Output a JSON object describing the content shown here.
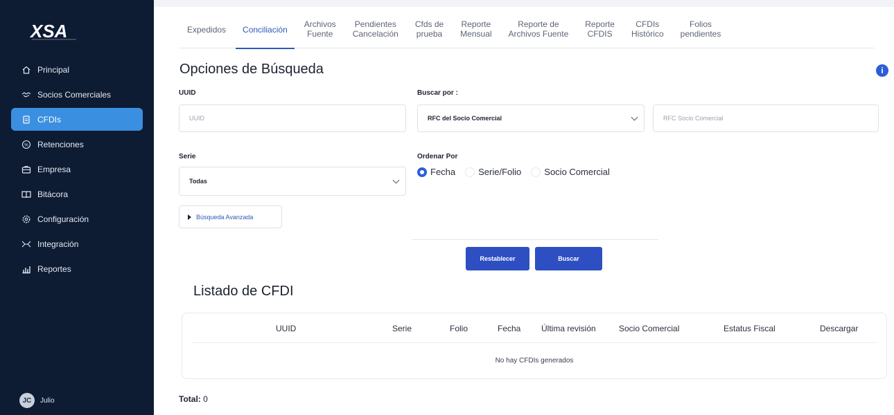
{
  "sidebar": {
    "logo_text": "XSA",
    "items": [
      {
        "label": "Principal",
        "icon": "home-icon"
      },
      {
        "label": "Socios Comerciales",
        "icon": "handshake-icon"
      },
      {
        "label": "CFDIs",
        "icon": "document-icon"
      },
      {
        "label": "Retenciones",
        "icon": "percent-circle-icon"
      },
      {
        "label": "Empresa",
        "icon": "briefcase-icon"
      },
      {
        "label": "Bitácora",
        "icon": "book-icon"
      },
      {
        "label": "Configuración",
        "icon": "gear-icon"
      },
      {
        "label": "Integración",
        "icon": "integration-icon"
      },
      {
        "label": "Reportes",
        "icon": "chart-icon"
      }
    ],
    "active_index": 2,
    "user": {
      "initials": "JC",
      "name": "Julio"
    }
  },
  "tabs": [
    "Expedidos",
    "Conciliación",
    "Archivos\nFuente",
    "Pendientes\nCancelación",
    "Cfds de\nprueba",
    "Reporte\nMensual",
    "Reporte de\nArchivos Fuente",
    "Reporte\nCFDIS",
    "CFDIs\nHistórico",
    "Folios\npendientes"
  ],
  "active_tab": "Conciliación",
  "search": {
    "title": "Opciones de Búsqueda",
    "uuid_label": "UUID",
    "uuid_placeholder": "UUID",
    "buscar_por_label": "Buscar por :",
    "buscar_por_value": "RFC del Socio Comercial",
    "rfc_placeholder": "RFC Socio Comercial",
    "serie_label": "Serie",
    "serie_value": "Todas",
    "ordenar_label": "Ordenar Por",
    "ordenar_options": [
      "Fecha",
      "Serie/Folio",
      "Socio Comercial"
    ],
    "ordenar_selected": "Fecha",
    "advanced_label": "Búsqueda Avanzada",
    "reset_button": "Restablecer",
    "search_button": "Buscar"
  },
  "listado": {
    "title": "Listado de CFDI",
    "columns": [
      "UUID",
      "Serie",
      "Folio",
      "Fecha",
      "Última revisión",
      "Socio Comercial",
      "Estatus Fiscal",
      "Descargar"
    ],
    "empty_message": "No hay CFDIs generados",
    "total_label": "Total:",
    "total_value": "0"
  },
  "colors": {
    "sidebar_bg": "#0d1b33",
    "active_nav": "#3a8fe0",
    "primary": "#2d4fc2",
    "tab_active": "#2f59b8"
  }
}
